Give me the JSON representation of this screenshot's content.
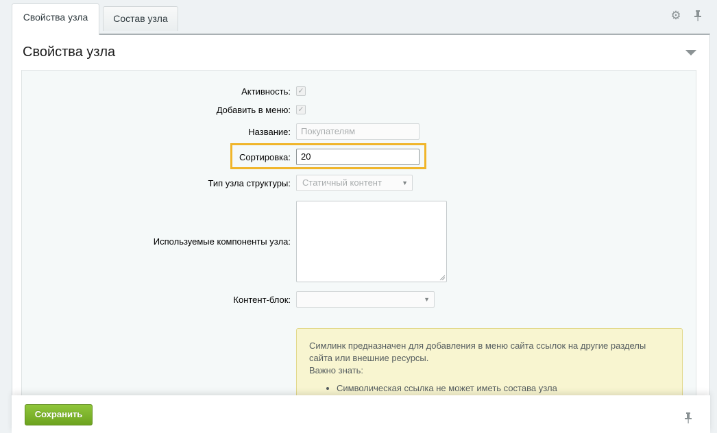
{
  "tabs": [
    {
      "label": "Свойства узла",
      "active": true
    },
    {
      "label": "Состав узла",
      "active": false
    }
  ],
  "toolbar": {
    "settings_icon": "gear-icon",
    "pin_icon": "pin-icon"
  },
  "panel": {
    "title": "Свойства узла"
  },
  "form": {
    "active_label": "Активность:",
    "add_menu_label": "Добавить в меню:",
    "name_label": "Название:",
    "name_placeholder": "Покупателям",
    "sort_label": "Сортировка:",
    "sort_value": "20",
    "node_type_label": "Тип узла структуры:",
    "node_type_value": "Статичный контент",
    "components_label": "Используемые компоненты узла:",
    "content_block_label": "Контент-блок:",
    "content_block_value": ""
  },
  "notice": {
    "line1": "Симлинк предназначен для добавления в меню сайта ссылок на другие разделы",
    "line2": "сайта или внешние ресурсы.",
    "line3": "Важно знать:",
    "bullet1": "Символическая ссылка не может иметь состава узла"
  },
  "footer": {
    "save_label": "Сохранить"
  },
  "colors": {
    "accent_highlight": "#f0b52a",
    "save_button": "#7bb42a",
    "notice_bg": "#f8f5d0"
  }
}
